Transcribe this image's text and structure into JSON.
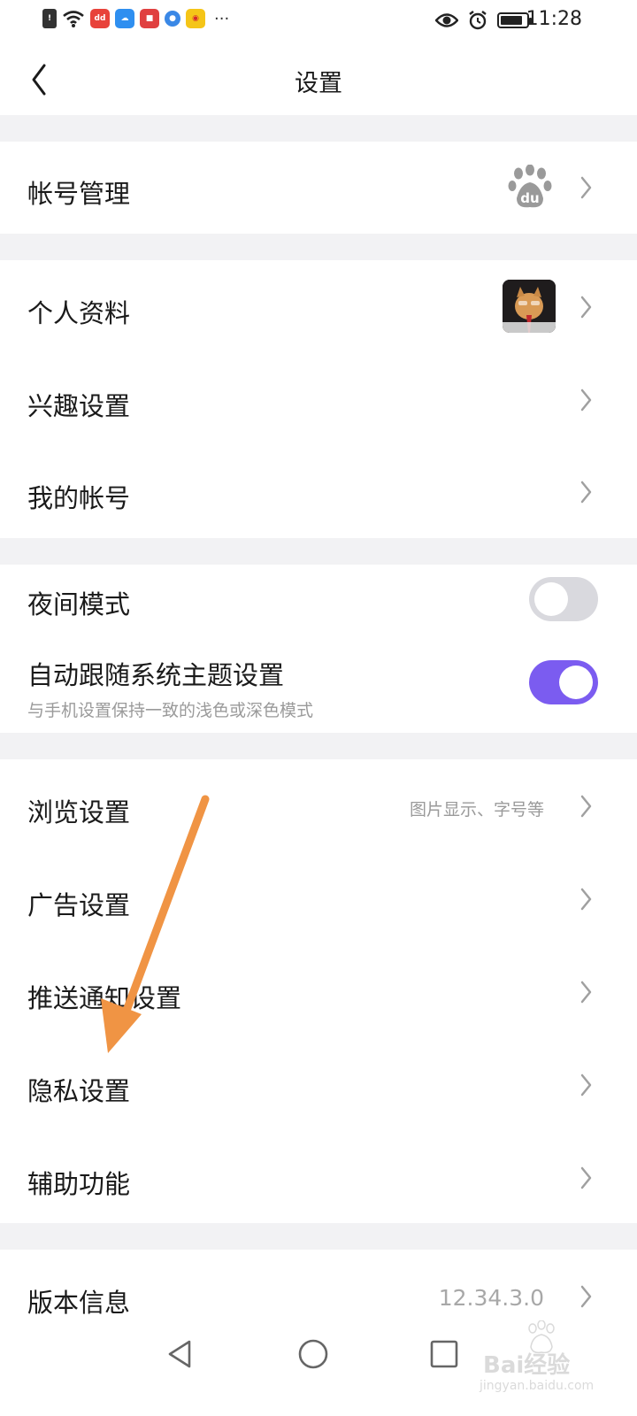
{
  "status_bar": {
    "time": "11:28",
    "more": "···",
    "app_icons": [
      {
        "name": "alert-icon",
        "color": "#333333",
        "glyph": "!"
      },
      {
        "name": "wifi-icon"
      },
      {
        "name": "app-red-icon",
        "color": "#e8423a",
        "glyph": "dd"
      },
      {
        "name": "weather-app-icon",
        "color": "#2f8ff0",
        "glyph": "☁"
      },
      {
        "name": "app-red2-icon",
        "color": "#e04040",
        "glyph": "■"
      },
      {
        "name": "browser-app-icon",
        "color": "#3a88e6",
        "glyph": "●"
      },
      {
        "name": "weibo-app-icon",
        "color": "#f5c518",
        "glyph": "◉"
      }
    ]
  },
  "header": {
    "title": "设置",
    "back_icon": "chevron-left-icon"
  },
  "groups": {
    "account": {
      "label": "帐号管理",
      "icon": "baidu-paw-icon"
    },
    "profile": [
      {
        "id": "personal-info",
        "label": "个人资料",
        "avatar": true
      },
      {
        "id": "interest-settings",
        "label": "兴趣设置"
      },
      {
        "id": "my-account",
        "label": "我的帐号"
      }
    ],
    "theme": {
      "night_mode": {
        "label": "夜间模式",
        "on": false
      },
      "auto_theme": {
        "label": "自动跟随系统主题设置",
        "sublabel": "与手机设置保持一致的浅色或深色模式",
        "on": true
      }
    },
    "settings": [
      {
        "id": "browse-settings",
        "label": "浏览设置",
        "value": "图片显示、字号等"
      },
      {
        "id": "ad-settings",
        "label": "广告设置"
      },
      {
        "id": "push-settings",
        "label": "推送通知设置"
      },
      {
        "id": "privacy-settings",
        "label": "隐私设置"
      },
      {
        "id": "accessibility",
        "label": "辅助功能"
      }
    ],
    "version": {
      "label": "版本信息",
      "value": "12.34.3.0"
    }
  },
  "colors": {
    "toggle_on": "#7b5cf0",
    "toggle_off": "#d9d9de",
    "annotation_arrow": "#f09444",
    "background": "#f2f2f4"
  },
  "watermark": {
    "main": "Bai经验",
    "sub": "jingyan.baidu.com"
  }
}
